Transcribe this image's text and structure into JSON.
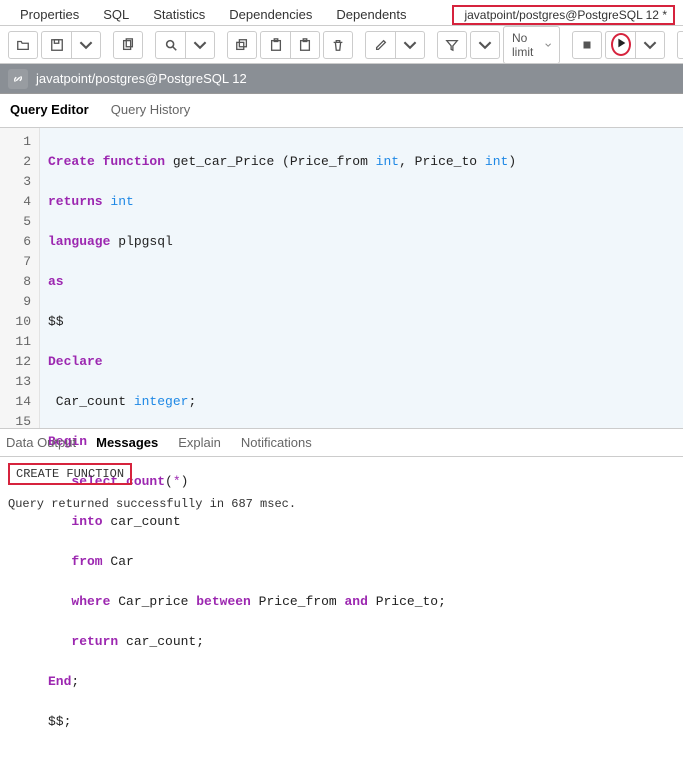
{
  "top_tabs": {
    "properties": "Properties",
    "sql": "SQL",
    "statistics": "Statistics",
    "dependencies": "Dependencies",
    "dependents": "Dependents",
    "conn_tab": "javatpoint/postgres@PostgreSQL 12 *"
  },
  "toolbar": {
    "limit_label": "No limit"
  },
  "conn_bar": {
    "text": "javatpoint/postgres@PostgreSQL 12"
  },
  "editor_tabs": {
    "query_editor": "Query Editor",
    "query_history": "Query History"
  },
  "code": {
    "lines": {
      "l1a": "Create function",
      "l1b": " get_car_Price (Price_from ",
      "l1c": "int",
      "l1d": ", Price_to ",
      "l1e": "int",
      "l1f": ")",
      "l2a": "returns ",
      "l2b": "int",
      "l3a": "language",
      "l3b": " plpgsql",
      "l4": "as",
      "l5": "$$",
      "l6": "Declare",
      "l7a": " Car_count ",
      "l7b": "integer",
      "l7c": ";",
      "l8": "Begin",
      "l9a": "   select ",
      "l9b": "count",
      "l9c": "(",
      "l9d": "*",
      "l9e": ")",
      "l10a": "   into",
      "l10b": " car_count",
      "l11a": "   from",
      "l11b": " Car",
      "l12a": "   where",
      "l12b": " Car_price ",
      "l12c": "between",
      "l12d": " Price_from ",
      "l12e": "and",
      "l12f": " Price_to;",
      "l13a": "   return",
      "l13b": " car_count;",
      "l14a": "End",
      "l14b": ";",
      "l15": "$$;"
    },
    "line_numbers": [
      "1",
      "2",
      "3",
      "4",
      "5",
      "6",
      "7",
      "8",
      "9",
      "10",
      "11",
      "12",
      "13",
      "14",
      "15"
    ]
  },
  "bottom_tabs": {
    "data_output": "Data Output",
    "messages": "Messages",
    "explain": "Explain",
    "notifications": "Notifications"
  },
  "output": {
    "result": "CREATE FUNCTION",
    "status": "Query returned successfully in 687 msec."
  }
}
